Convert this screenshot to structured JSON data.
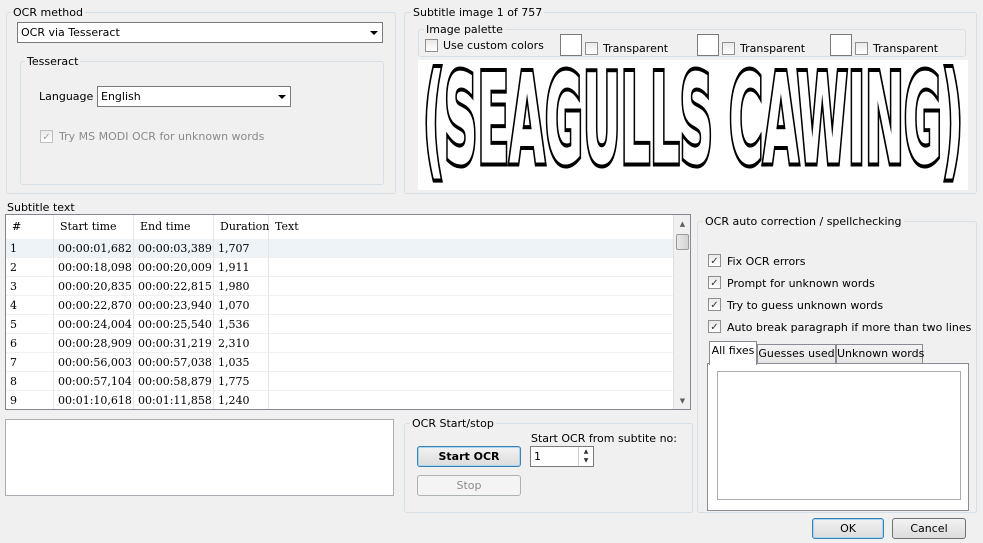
{
  "ocr_method": {
    "legend": "OCR method",
    "selected": "OCR via Tesseract",
    "tesseract": {
      "legend": "Tesseract",
      "language_label": "Language",
      "language_value": "English",
      "modi_label": "Try MS MODI OCR for unknown words"
    }
  },
  "subtitle_image": {
    "legend": "Subtitle image 1 of 757",
    "palette_legend": "Image palette",
    "use_custom_colors": "Use custom colors",
    "transparent_label": "Transparent",
    "image_text": "(SEAGULLS CAWING)"
  },
  "subtitle_text": {
    "label": "Subtitle text",
    "columns": [
      "#",
      "Start time",
      "End time",
      "Duration",
      "Text"
    ],
    "rows": [
      {
        "num": "1",
        "start": "00:00:01,682",
        "end": "00:00:03,389",
        "duration": "1,707",
        "text": ""
      },
      {
        "num": "2",
        "start": "00:00:18,098",
        "end": "00:00:20,009",
        "duration": "1,911",
        "text": ""
      },
      {
        "num": "3",
        "start": "00:00:20,835",
        "end": "00:00:22,815",
        "duration": "1,980",
        "text": ""
      },
      {
        "num": "4",
        "start": "00:00:22,870",
        "end": "00:00:23,940",
        "duration": "1,070",
        "text": ""
      },
      {
        "num": "5",
        "start": "00:00:24,004",
        "end": "00:00:25,540",
        "duration": "1,536",
        "text": ""
      },
      {
        "num": "6",
        "start": "00:00:28,909",
        "end": "00:00:31,219",
        "duration": "2,310",
        "text": ""
      },
      {
        "num": "7",
        "start": "00:00:56,003",
        "end": "00:00:57,038",
        "duration": "1,035",
        "text": ""
      },
      {
        "num": "8",
        "start": "00:00:57,104",
        "end": "00:00:58,879",
        "duration": "1,775",
        "text": ""
      },
      {
        "num": "9",
        "start": "00:01:10,618",
        "end": "00:01:11,858",
        "duration": "1,240",
        "text": ""
      }
    ]
  },
  "ocr_start_stop": {
    "legend": "OCR Start/stop",
    "start_from_label": "Start OCR from subtite no:",
    "start_from_value": "1",
    "start_button": "Start OCR",
    "stop_button": "Stop"
  },
  "auto_correction": {
    "legend": "OCR auto correction / spellchecking",
    "fix_ocr_errors": "Fix OCR errors",
    "prompt_unknown": "Prompt for unknown words",
    "guess_unknown": "Try to guess unknown words",
    "auto_break": "Auto break paragraph if more than two lines",
    "tabs": [
      "All fixes",
      "Guesses used",
      "Unknown words"
    ]
  },
  "footer": {
    "ok_button": "OK",
    "cancel_button": "Cancel"
  }
}
